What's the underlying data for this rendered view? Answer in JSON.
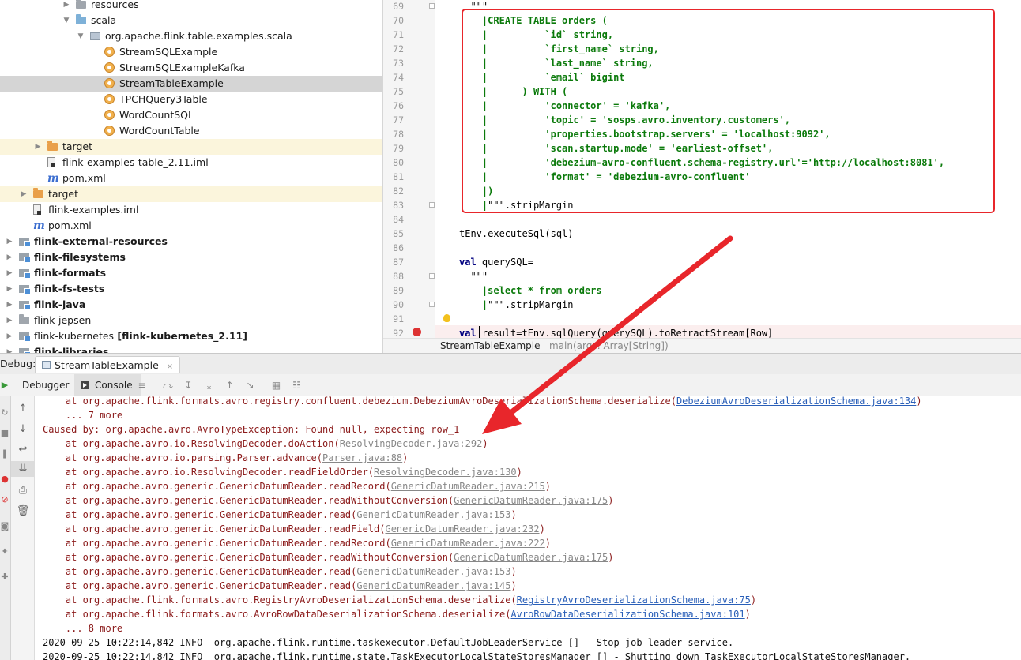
{
  "tree": {
    "items": [
      {
        "label": "resources",
        "bold": false,
        "icon": "folder-gray-icon",
        "indent": 96,
        "arrow": "right"
      },
      {
        "label": "scala",
        "bold": false,
        "icon": "folder-blue-icon",
        "indent": 96,
        "arrow": "down"
      },
      {
        "label": "org.apache.flink.table.examples.scala",
        "bold": false,
        "icon": "package-icon",
        "indent": 114,
        "arrow": "down"
      },
      {
        "label": "StreamSQLExample",
        "bold": false,
        "icon": "scala-object-icon",
        "indent": 132,
        "arrow": ""
      },
      {
        "label": "StreamSQLExampleKafka",
        "bold": false,
        "icon": "scala-object-icon",
        "indent": 132,
        "arrow": ""
      },
      {
        "label": "StreamTableExample",
        "bold": false,
        "icon": "scala-object-icon",
        "indent": 132,
        "arrow": "",
        "selected": true
      },
      {
        "label": "TPCHQuery3Table",
        "bold": false,
        "icon": "scala-object-icon",
        "indent": 132,
        "arrow": ""
      },
      {
        "label": "WordCountSQL",
        "bold": false,
        "icon": "scala-object-icon",
        "indent": 132,
        "arrow": ""
      },
      {
        "label": "WordCountTable",
        "bold": false,
        "icon": "scala-object-icon",
        "indent": 132,
        "arrow": ""
      },
      {
        "label": "target",
        "bold": false,
        "icon": "folder-orange-icon",
        "indent": 60,
        "arrow": "right",
        "excluded": true
      },
      {
        "label": "flink-examples-table_2.11.iml",
        "bold": false,
        "icon": "iml-file-icon",
        "indent": 60,
        "arrow": ""
      },
      {
        "label": "pom.xml",
        "bold": false,
        "icon": "maven-pom-icon",
        "indent": 60,
        "arrow": ""
      },
      {
        "label": "target",
        "bold": false,
        "icon": "folder-orange-icon",
        "indent": 42,
        "arrow": "right",
        "excluded": true
      },
      {
        "label": "flink-examples.iml",
        "bold": false,
        "icon": "iml-file-icon",
        "indent": 42,
        "arrow": ""
      },
      {
        "label": "pom.xml",
        "bold": false,
        "icon": "maven-pom-icon",
        "indent": 42,
        "arrow": ""
      },
      {
        "label": "flink-external-resources",
        "bold": true,
        "icon": "module-folder-icon",
        "indent": 24,
        "arrow": "right"
      },
      {
        "label": "flink-filesystems",
        "bold": true,
        "icon": "module-folder-icon",
        "indent": 24,
        "arrow": "right"
      },
      {
        "label": "flink-formats",
        "bold": true,
        "icon": "module-folder-icon",
        "indent": 24,
        "arrow": "right"
      },
      {
        "label": "flink-fs-tests",
        "bold": true,
        "icon": "module-folder-icon",
        "indent": 24,
        "arrow": "right"
      },
      {
        "label": "flink-java",
        "bold": true,
        "icon": "module-folder-icon",
        "indent": 24,
        "arrow": "right"
      },
      {
        "label": "flink-jepsen",
        "bold": false,
        "icon": "folder-gray-icon",
        "indent": 24,
        "arrow": "right"
      },
      {
        "label": "flink-kubernetes",
        "suffix": " [flink-kubernetes_2.11]",
        "bold": false,
        "icon": "module-folder-icon",
        "indent": 24,
        "arrow": "right"
      },
      {
        "label": "flink-libraries",
        "bold": true,
        "icon": "module-folder-icon",
        "indent": 24,
        "arrow": "right"
      }
    ]
  },
  "editor": {
    "lines": [
      {
        "n": "69",
        "pre": "  ",
        "text": "\"\"\"",
        "kind": "plain"
      },
      {
        "n": "70",
        "pre": "    ",
        "text": "CREATE TABLE orders (",
        "kind": "sql"
      },
      {
        "n": "71",
        "pre": "    ",
        "text": "          `id` string,",
        "kind": "sql"
      },
      {
        "n": "72",
        "pre": "    ",
        "text": "          `first_name` string,",
        "kind": "sql"
      },
      {
        "n": "73",
        "pre": "    ",
        "text": "          `last_name` string,",
        "kind": "sql"
      },
      {
        "n": "74",
        "pre": "    ",
        "text": "          `email` bigint",
        "kind": "sql"
      },
      {
        "n": "75",
        "pre": "    ",
        "text": "      ) WITH (",
        "kind": "sql"
      },
      {
        "n": "76",
        "pre": "    ",
        "text": "          'connector' = 'kafka',",
        "kind": "sql"
      },
      {
        "n": "77",
        "pre": "    ",
        "text": "          'topic' = 'sosps.avro.inventory.customers',",
        "kind": "sql"
      },
      {
        "n": "78",
        "pre": "    ",
        "text": "          'properties.bootstrap.servers' = 'localhost:9092',",
        "kind": "sql"
      },
      {
        "n": "79",
        "pre": "    ",
        "text": "          'scan.startup.mode' = 'earliest-offset',",
        "kind": "sql"
      },
      {
        "n": "80",
        "pre": "    ",
        "text": "          'debezium-avro-confluent.schema-registry.url'='http://localhost:8081',",
        "kind": "sql"
      },
      {
        "n": "81",
        "pre": "    ",
        "text": "          'format' = 'debezium-avro-confluent'",
        "kind": "sql"
      },
      {
        "n": "82",
        "pre": "    ",
        "text": ")",
        "kind": "sql"
      },
      {
        "n": "83",
        "pre": "    ",
        "text": "\"\"\".stripMargin",
        "kind": "end"
      },
      {
        "n": "84",
        "pre": "",
        "text": "",
        "kind": "plain"
      },
      {
        "n": "85",
        "pre": "",
        "text": "tEnv.executeSql(sql)",
        "kind": "plain"
      },
      {
        "n": "86",
        "pre": "",
        "text": "",
        "kind": "plain"
      },
      {
        "n": "87",
        "pre": "",
        "text": "querySQL=",
        "kind": "val"
      },
      {
        "n": "88",
        "pre": "  ",
        "text": "\"\"\"",
        "kind": "plain"
      },
      {
        "n": "89",
        "pre": "    ",
        "text": "select * from orders",
        "kind": "sql"
      },
      {
        "n": "90",
        "pre": "    ",
        "text": "\"\"\".stripMargin",
        "kind": "end"
      },
      {
        "n": "91",
        "pre": "",
        "text": "",
        "kind": "plain"
      },
      {
        "n": "92",
        "pre": "",
        "text": "result=tEnv.sqlQuery(querySQL).toRetractStream[Row]",
        "kind": "val"
      }
    ],
    "pipe": "|",
    "val_kw": "val"
  },
  "breadcrumb": {
    "file": "StreamTableExample",
    "sep": "›",
    "method": "main(args: Array[String])"
  },
  "debug": {
    "title": "Debug:",
    "tab": "StreamTableExample",
    "close": "×",
    "tabs": {
      "debugger": "Debugger",
      "console": "Console"
    }
  },
  "console": {
    "lines": [
      {
        "t": "    at org.apache.flink.formats.avro.registry.confluent.debezium.DebeziumAvroDeserializationSchema.deserialize(",
        "link": "DebeziumAvroDeserializationSchema.java:134",
        "tail": ")",
        "style": "blue"
      },
      {
        "t": "    ... 7 more",
        "link": "",
        "tail": "",
        "style": ""
      },
      {
        "t": "Caused by: org.apache.avro.AvroTypeException: Found null, expecting row_1",
        "link": "",
        "tail": "",
        "style": ""
      },
      {
        "t": "    at org.apache.avro.io.ResolvingDecoder.doAction(",
        "link": "ResolvingDecoder.java:292",
        "tail": ")",
        "style": "gray"
      },
      {
        "t": "    at org.apache.avro.io.parsing.Parser.advance(",
        "link": "Parser.java:88",
        "tail": ")",
        "style": "gray"
      },
      {
        "t": "    at org.apache.avro.io.ResolvingDecoder.readFieldOrder(",
        "link": "ResolvingDecoder.java:130",
        "tail": ")",
        "style": "gray"
      },
      {
        "t": "    at org.apache.avro.generic.GenericDatumReader.readRecord(",
        "link": "GenericDatumReader.java:215",
        "tail": ")",
        "style": "gray"
      },
      {
        "t": "    at org.apache.avro.generic.GenericDatumReader.readWithoutConversion(",
        "link": "GenericDatumReader.java:175",
        "tail": ")",
        "style": "gray"
      },
      {
        "t": "    at org.apache.avro.generic.GenericDatumReader.read(",
        "link": "GenericDatumReader.java:153",
        "tail": ")",
        "style": "gray"
      },
      {
        "t": "    at org.apache.avro.generic.GenericDatumReader.readField(",
        "link": "GenericDatumReader.java:232",
        "tail": ")",
        "style": "gray"
      },
      {
        "t": "    at org.apache.avro.generic.GenericDatumReader.readRecord(",
        "link": "GenericDatumReader.java:222",
        "tail": ")",
        "style": "gray"
      },
      {
        "t": "    at org.apache.avro.generic.GenericDatumReader.readWithoutConversion(",
        "link": "GenericDatumReader.java:175",
        "tail": ")",
        "style": "gray"
      },
      {
        "t": "    at org.apache.avro.generic.GenericDatumReader.read(",
        "link": "GenericDatumReader.java:153",
        "tail": ")",
        "style": "gray"
      },
      {
        "t": "    at org.apache.avro.generic.GenericDatumReader.read(",
        "link": "GenericDatumReader.java:145",
        "tail": ")",
        "style": "gray"
      },
      {
        "t": "    at org.apache.flink.formats.avro.RegistryAvroDeserializationSchema.deserialize(",
        "link": "RegistryAvroDeserializationSchema.java:75",
        "tail": ")",
        "style": "blue"
      },
      {
        "t": "    at org.apache.flink.formats.avro.AvroRowDataDeserializationSchema.deserialize(",
        "link": "AvroRowDataDeserializationSchema.java:101",
        "tail": ")",
        "style": "blue"
      },
      {
        "t": "    ... 8 more",
        "link": "",
        "tail": "",
        "style": ""
      },
      {
        "t": "2020-09-25 10:22:14,842 INFO  org.apache.flink.runtime.taskexecutor.DefaultJobLeaderService [] - Stop job leader service.",
        "link": "",
        "tail": "",
        "style": "info"
      },
      {
        "t": "2020-09-25 10:22:14,842 INFO  org.apache.flink.runtime.state.TaskExecutorLocalStateStoresManager [] - Shutting down TaskExecutorLocalStateStoresManager.",
        "link": "",
        "tail": "",
        "style": "info"
      }
    ]
  },
  "colors": {
    "annotation_red": "#e8262b",
    "sql_green": "#0b7a0b",
    "keyword_navy": "#000080",
    "error_text": "#8b1a1a",
    "link_blue": "#2a5fb8"
  }
}
